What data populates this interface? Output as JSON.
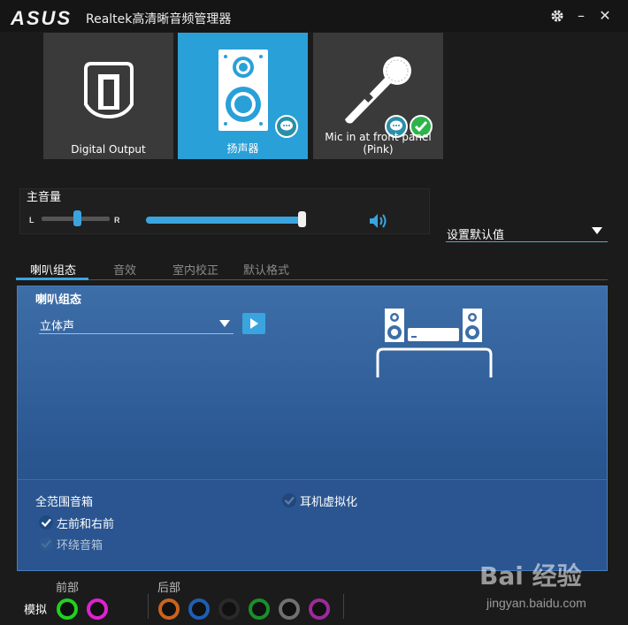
{
  "titlebar": {
    "brand": "ASUS",
    "title": "Realtek高清晰音频管理器",
    "settings_icon": "gear-icon",
    "minimize": "–",
    "close": "✕"
  },
  "devices": [
    {
      "label": "Digital Output",
      "icon": "digital-output-icon",
      "active": false
    },
    {
      "label": "扬声器",
      "icon": "speaker-cabinet-icon",
      "active": true
    },
    {
      "label": "Mic in at front panel (Pink)",
      "icon": "microphone-icon",
      "active": false
    }
  ],
  "volume": {
    "title": "主音量",
    "left": "L",
    "right": "R",
    "balance": 0.5,
    "level": 1.0,
    "mute_icon": "speaker-volume-icon"
  },
  "default_device": {
    "label": "设置默认值"
  },
  "tabs": [
    "喇叭组态",
    "音效",
    "室内校正",
    "默认格式"
  ],
  "active_tab": 0,
  "speaker_config": {
    "title": "喇叭组态",
    "selected": "立体声",
    "play_icon": "play-icon"
  },
  "options": {
    "fullrange_title": "全范围音箱",
    "front_lr": {
      "label": "左前和右前",
      "checked": true
    },
    "surround": {
      "label": "环绕音箱",
      "checked": false
    },
    "headphone_virtualization": {
      "label": "耳机虚拟化",
      "checked": false
    }
  },
  "jacks": {
    "analog_label": "模拟",
    "front_label": "前部",
    "rear_label": "后部",
    "front": [
      "#1fd21f",
      "#e021d0"
    ],
    "rear": [
      "#c8641e",
      "#1e5fb4",
      "#2a2a2a",
      "#1b8f2a",
      "#707070",
      "#9c2a9c"
    ]
  },
  "watermark": {
    "logo": "Bai 经验",
    "url": "jingyan.baidu.com"
  }
}
